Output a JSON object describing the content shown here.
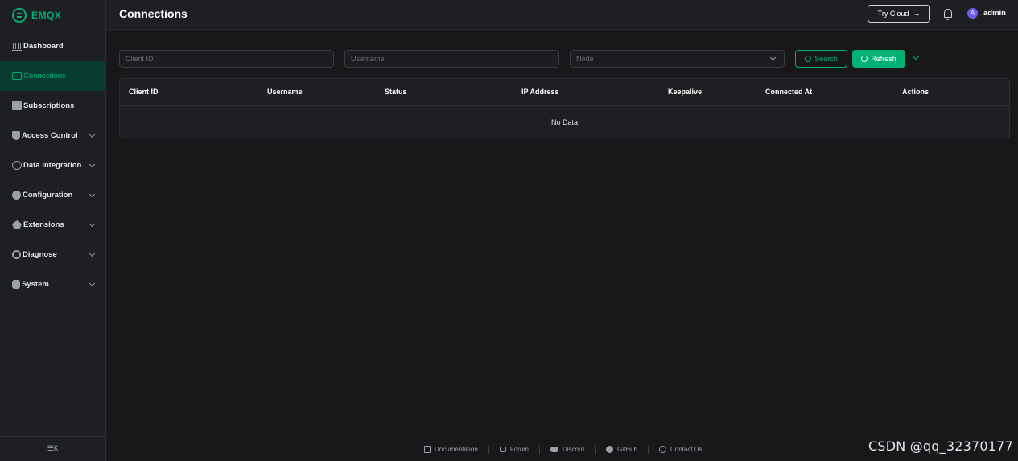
{
  "app": {
    "logo_text": "EMQX"
  },
  "sidebar": {
    "items": [
      {
        "label": "Dashboard",
        "icon": "dashboard-icon"
      },
      {
        "label": "Connections",
        "icon": "connections-icon",
        "active": true
      },
      {
        "label": "Subscriptions",
        "icon": "subscriptions-icon"
      },
      {
        "label": "Access Control",
        "icon": "shield-icon",
        "expandable": true
      },
      {
        "label": "Data Integration",
        "icon": "data-integration-icon",
        "expandable": true
      },
      {
        "label": "Configuration",
        "icon": "gear-icon",
        "expandable": true
      },
      {
        "label": "Extensions",
        "icon": "extensions-icon",
        "expandable": true
      },
      {
        "label": "Diagnose",
        "icon": "diagnose-icon",
        "expandable": true
      },
      {
        "label": "System",
        "icon": "system-icon",
        "expandable": true
      }
    ],
    "collapse_glyph": "☰K"
  },
  "header": {
    "title": "Connections",
    "try_cloud_label": "Try Cloud",
    "try_cloud_arrow": "→",
    "avatar_initial": "A",
    "user_name": "admin"
  },
  "filters": {
    "client_id_placeholder": "Client ID",
    "username_placeholder": "Username",
    "node_placeholder": "Node",
    "search_label": "Search",
    "refresh_label": "Refresh"
  },
  "table": {
    "columns": [
      "Client ID",
      "Username",
      "Status",
      "IP Address",
      "Keepalive",
      "Connected At",
      "Actions"
    ],
    "rows": [],
    "empty_text": "No Data"
  },
  "footer": {
    "links": [
      "Documentation",
      "Forum",
      "Discord",
      "GitHub",
      "Contact Us"
    ]
  },
  "watermark": "CSDN @qq_32370177",
  "colors": {
    "accent": "#00b173",
    "background": "#18181a",
    "panel": "#1e1f22",
    "avatar": "#6f5bf6"
  }
}
